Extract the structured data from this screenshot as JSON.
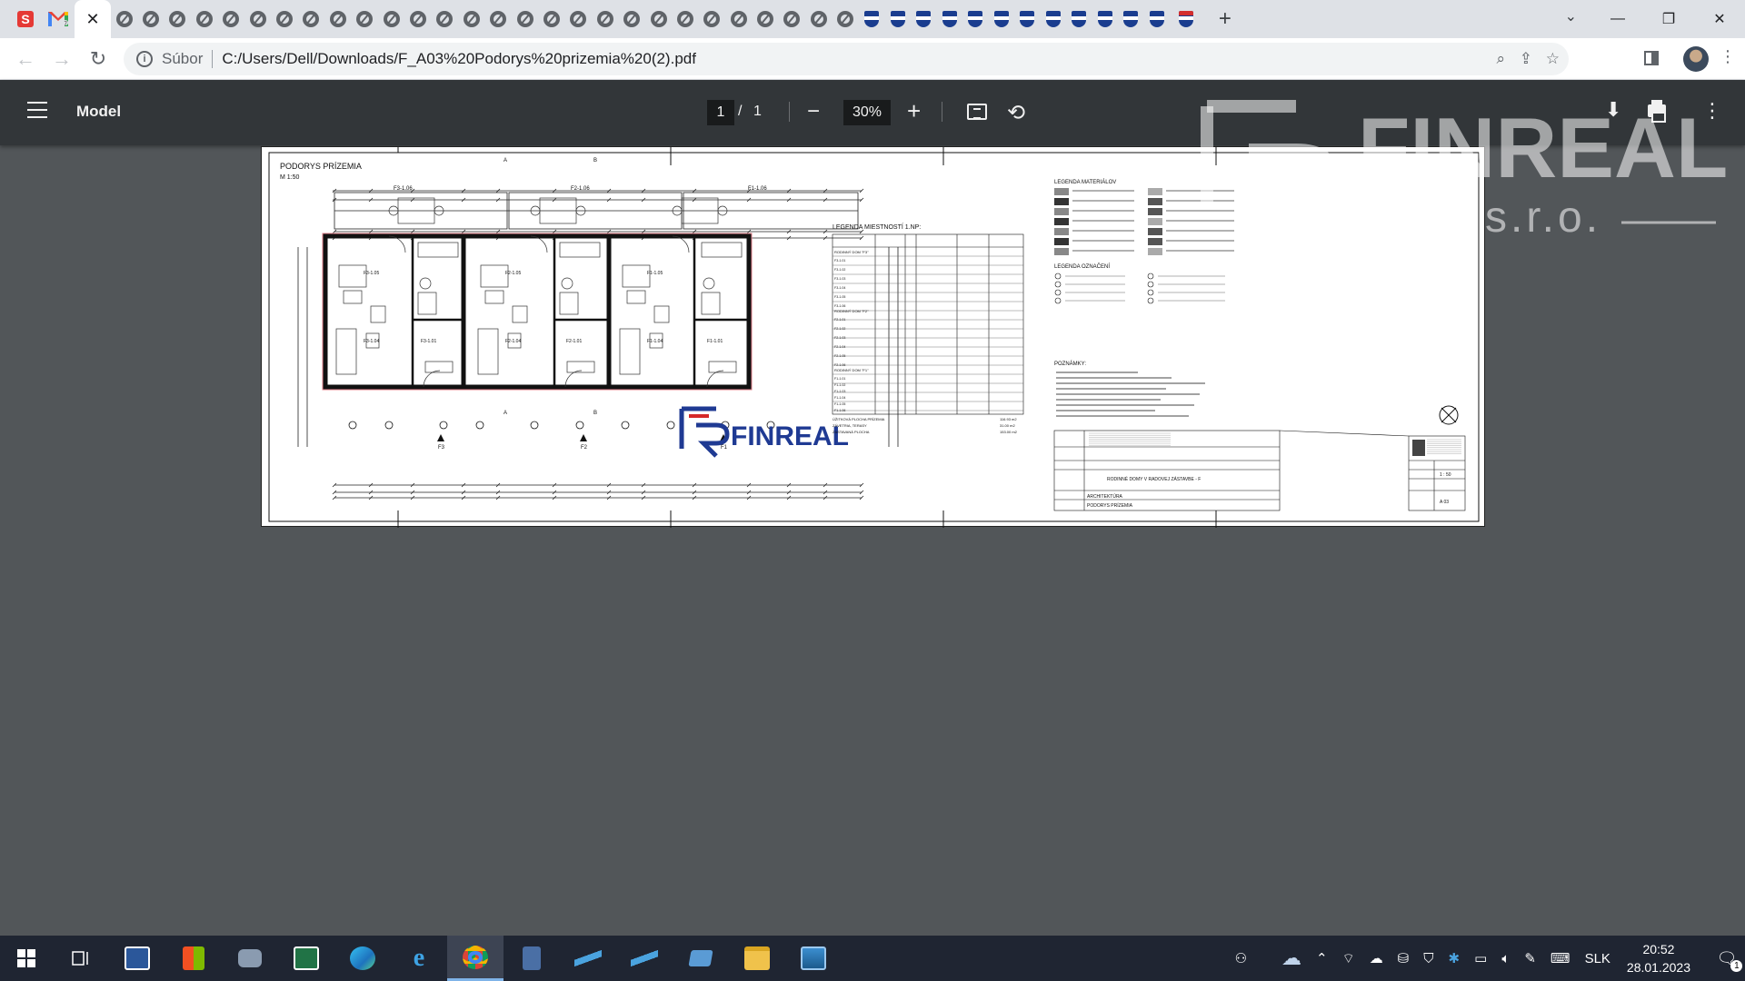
{
  "browser": {
    "tabs_globe_count": 28,
    "tabs_shield_count": 12,
    "url_label": "Súbor",
    "url": "C:/Users/Dell/Downloads/F_A03%20Podorys%20prizemia%20(2).pdf"
  },
  "pdf": {
    "title": "Model",
    "page_current": "1",
    "page_sep": "/",
    "page_total": "1",
    "zoom": "30%"
  },
  "watermark": {
    "brand": "FINREAL",
    "suffix": "s.r.o."
  },
  "drawing": {
    "title": "PODORYS PRÍZEMIA",
    "scale": "M 1:50",
    "logo_text": "FINREAL",
    "unit_labels_top": [
      "F3-1.06",
      "F2-1.06",
      "F1-1.06"
    ],
    "unit_labels_rooms": [
      "F3-1.05",
      "F2-1.05",
      "F1-1.05",
      "F3-1.04",
      "F2-1.04",
      "F1-1.04",
      "F3-1.01",
      "F2-1.01",
      "F1-1.01"
    ],
    "axis_labels": [
      "F3",
      "F2",
      "F1"
    ],
    "section_marks": [
      "A",
      "B",
      "A",
      "B"
    ],
    "legend_rooms_title": "LEGENDA MIESTNOSTÍ 1.NP:",
    "legend_rooms_groups": [
      "RODINNÝ DOM \"F3\"",
      "RODINNÝ DOM \"F2\"",
      "RODINNÝ DOM \"F1\""
    ],
    "legend_rooms_codes": [
      [
        "F3-1.01",
        "F3-1.02",
        "F3-1.03",
        "F3-1.04",
        "F3-1.05",
        "F3-1.06"
      ],
      [
        "F2-1.01",
        "F2-1.02",
        "F2-1.03",
        "F2-1.04",
        "F2-1.05",
        "F2-1.06"
      ],
      [
        "F1-1.01",
        "F1-1.02",
        "F1-1.03",
        "F1-1.04",
        "F1-1.05",
        "F1-1.06"
      ]
    ],
    "legend_totals": [
      "ÚŽITKOVÁ PLOCHA PRÍZEMIA",
      "ZÁVETRIA, TERASY",
      "ZASTAVANÁ PLOCHA"
    ],
    "legend_totals_values": [
      "116.93 m2",
      "31.00 m2",
      "153.00 m2"
    ],
    "legend_materials_title": "LEGENDA MATERIÁLOV",
    "legend_marks_title": "LEGENDA OZNAČENÍ",
    "notes_title": "POZNÁMKY:",
    "titleblock_project": "RODINNÉ DOMY V RADOVEJ ZÁSTAVBE - F",
    "titleblock_part": "ARCHITEKTÚRA",
    "titleblock_drawing": "PODORYS PRÍZEMIA",
    "titleblock_sheet": "A 03",
    "titleblock_scale": "1 : 50"
  },
  "taskbar": {
    "language": "SLK",
    "time": "20:52",
    "date": "28.01.2023",
    "notifications": "1"
  }
}
